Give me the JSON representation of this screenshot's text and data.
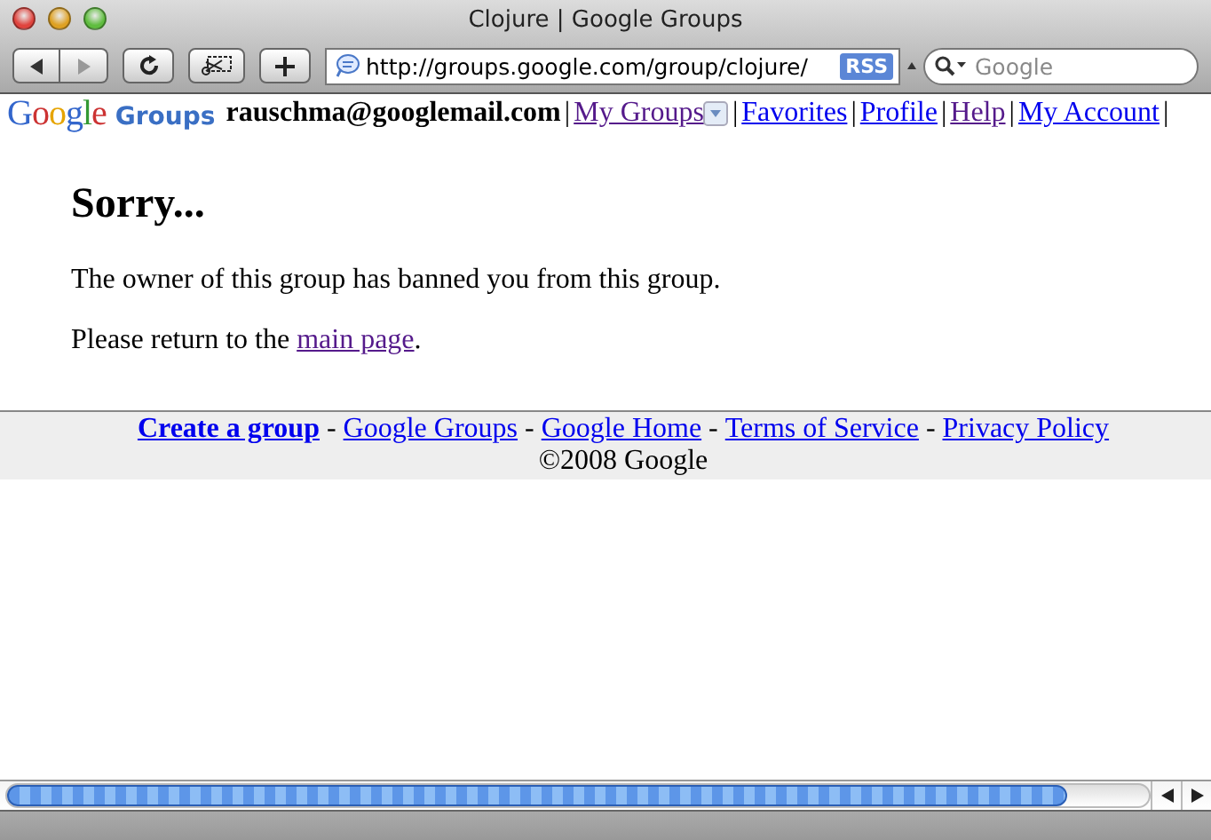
{
  "window": {
    "title": "Clojure | Google Groups"
  },
  "toolbar": {
    "address": "http://groups.google.com/group/clojure/",
    "rss": "RSS",
    "search": {
      "placeholder": "Google"
    }
  },
  "header": {
    "logo": {
      "word": "Google",
      "product": "Groups"
    },
    "user": "rauschma@googlemail.com",
    "links": [
      {
        "label": "My Groups",
        "visited": true,
        "kind": "dropdown"
      },
      {
        "label": "Favorites",
        "visited": false,
        "kind": "link"
      },
      {
        "label": "Profile",
        "visited": false,
        "kind": "link"
      },
      {
        "label": "Help",
        "visited": true,
        "kind": "link"
      },
      {
        "label": "My Account",
        "visited": false,
        "kind": "link"
      }
    ],
    "separator": "|"
  },
  "message": {
    "heading": "Sorry...",
    "text": "The owner of this group has banned you from this group.",
    "return_prefix": "Please return to the",
    "return_link": {
      "label": "main page",
      "visited": true
    },
    "return_suffix": "."
  },
  "footer": {
    "links": [
      {
        "label": "Create a group",
        "bold": true
      },
      {
        "label": "Google Groups",
        "bold": false
      },
      {
        "label": "Google Home",
        "bold": false
      },
      {
        "label": "Terms of Service",
        "bold": false
      },
      {
        "label": "Privacy Policy",
        "bold": false
      }
    ],
    "separator": "-",
    "copyright": "©2008 Google"
  }
}
